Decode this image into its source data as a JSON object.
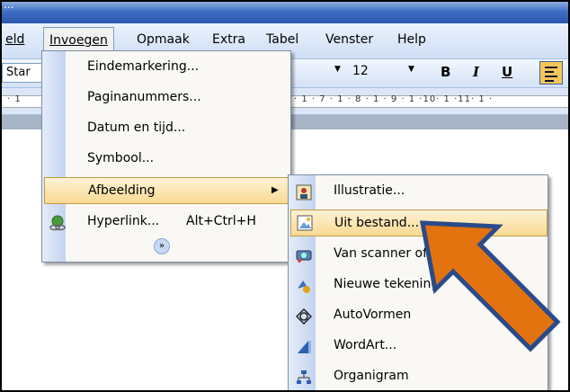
{
  "titlebar": {
    "text": "..."
  },
  "menubar": {
    "items": [
      {
        "label": "eld"
      },
      {
        "label": "Invoegen"
      },
      {
        "label": "Opmaak"
      },
      {
        "label": "Extra"
      },
      {
        "label": "Tabel"
      },
      {
        "label": "Venster"
      },
      {
        "label": "Help"
      }
    ]
  },
  "toolbar": {
    "style_value": "Star",
    "font_size": "12",
    "bold": "B",
    "italic": "I",
    "underline": "U"
  },
  "ruler": {
    "left_ticks": "· 1",
    "right_ticks": "· 1 · 7 · 1 · 8 · 1 · 9 · 1 ·10· 1 ·11· 1 ·"
  },
  "insert_menu": {
    "items": [
      {
        "label": "Eindemarkering..."
      },
      {
        "label": "Paginanummers..."
      },
      {
        "label": "Datum en tijd..."
      },
      {
        "label": "Symbool..."
      },
      {
        "label": "Afbeelding"
      },
      {
        "label": "Hyperlink...",
        "shortcut": "Alt+Ctrl+H"
      }
    ],
    "expand_icon": "double-chevron-down-icon"
  },
  "picture_submenu": {
    "items": [
      {
        "label": "Illustratie...",
        "icon": "clipart-icon"
      },
      {
        "label": "Uit bestand...",
        "icon": "picture-file-icon"
      },
      {
        "label": "Van scanner of camera...",
        "icon": "scanner-icon"
      },
      {
        "label": "Nieuwe tekening",
        "icon": "drawing-icon"
      },
      {
        "label": "AutoVormen",
        "icon": "autoshapes-icon"
      },
      {
        "label": "WordArt...",
        "icon": "wordart-icon"
      },
      {
        "label": "Organigram",
        "icon": "org-chart-icon"
      }
    ]
  },
  "colors": {
    "highlight": "#f9da92",
    "arrow_fill": "#e2730f",
    "arrow_outline": "#2a4a8a"
  }
}
